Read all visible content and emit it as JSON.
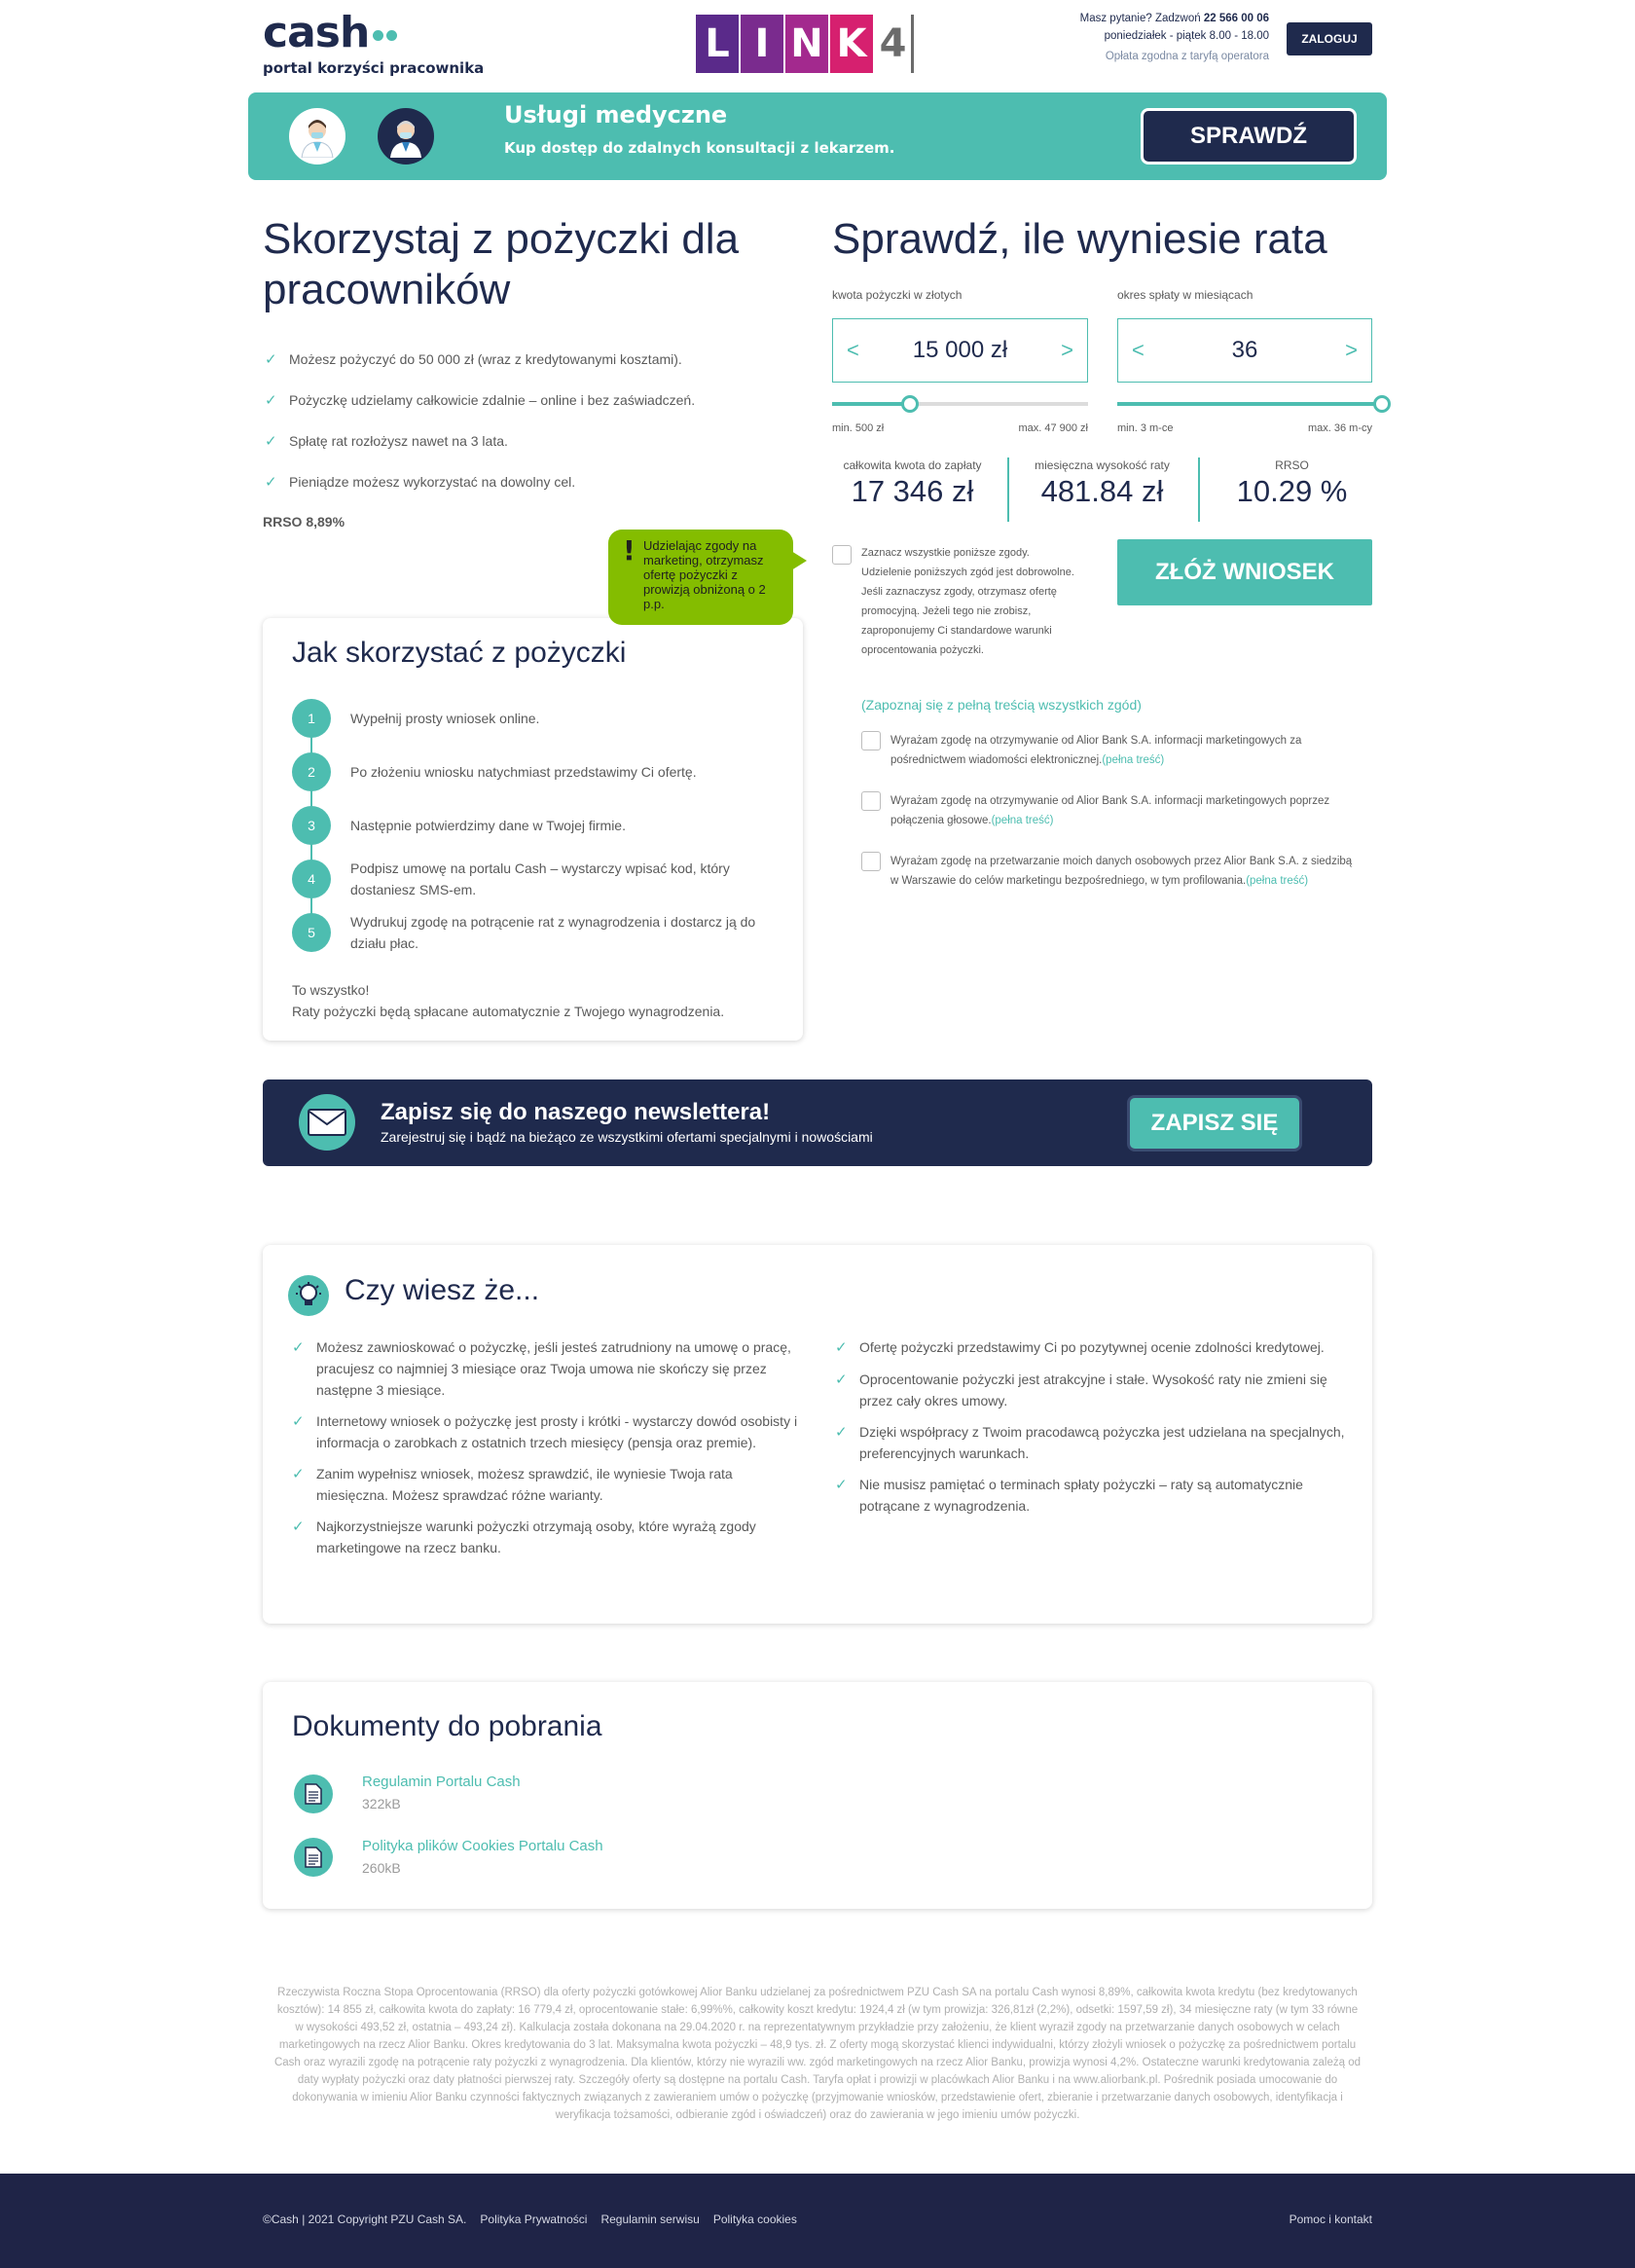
{
  "header": {
    "logo_text": "cash",
    "logo_sub": "portal korzyści pracownika",
    "partner_letters": [
      "L",
      "I",
      "N",
      "K",
      "4"
    ],
    "partner_colors": [
      "#5a2a8a",
      "#7a2b8e",
      "#a3298e",
      "#d6206f"
    ],
    "contact_question": "Masz pytanie? Zadzwoń",
    "contact_phone": "22 566 00 06",
    "contact_hours": "poniedziałek - piątek 8.00 - 18.00",
    "contact_fee": "Opłata zgodna z taryfą operatora",
    "login_label": "ZALOGUJ"
  },
  "banner": {
    "title": "Usługi medyczne",
    "subtitle": "Kup dostęp do zdalnych konsultacji z lekarzem.",
    "button_label": "SPRAWDŹ"
  },
  "intro": {
    "heading": "Skorzystaj z pożyczki dla pracowników",
    "benefits": [
      "Możesz pożyczyć do 50 000 zł (wraz z kredytowanymi kosztami).",
      "Pożyczkę udzielamy całkowicie zdalnie – online i bez zaświadczeń.",
      "Spłatę rat rozłożysz nawet na 3 lata.",
      "Pieniądze możesz wykorzystać na dowolny cel."
    ],
    "rrso": "RRSO 8,89%"
  },
  "steps": {
    "title": "Jak skorzystać z pożyczki",
    "items": [
      {
        "num": "1",
        "text": "Wypełnij prosty wniosek online."
      },
      {
        "num": "2",
        "text": "Po złożeniu wniosku natychmiast przedstawimy Ci ofertę."
      },
      {
        "num": "3",
        "text": "Następnie potwierdzimy dane w Twojej firmie."
      },
      {
        "num": "4",
        "text": "Podpisz umowę na portalu Cash – wystarczy wpisać kod, który dostaniesz SMS-em."
      },
      {
        "num": "5",
        "text": "Wydrukuj zgodę na potrącenie rat z wynagrodzenia i dostarcz ją do działu płac."
      }
    ],
    "outro_1": "To wszystko!",
    "outro_2": "Raty pożyczki będą spłacane automatycznie z Twojego wynagrodzenia."
  },
  "calculator": {
    "heading": "Sprawdź, ile wyniesie rata",
    "amount_label": "kwota pożyczki w złotych",
    "amount_value": "15 000 zł",
    "amount_min": "min. 500 zł",
    "amount_max": "max. 47 900 zł",
    "amount_fraction": 0.305,
    "period_label": "okres spłaty w miesiącach",
    "period_value": "36",
    "period_min": "min. 3 m-ce",
    "period_max": "max. 36 m-cy",
    "period_fraction": 1.0,
    "total_label": "całkowita kwota do zapłaty",
    "total_value": "17 346 zł",
    "installment_label": "miesięczna wysokość raty",
    "installment_value": "481.84 zł",
    "rrso_label": "RRSO",
    "rrso_value": "10.29 %",
    "apply_label": "ZŁÓŻ WNIOSEK"
  },
  "consents": {
    "bubble_mark": "!",
    "bubble_text": "Udzielając zgody na marketing, otrzymasz ofertę pożyczki z prowizją obniżoną o 2 p.p.",
    "select_all": "Zaznacz wszystkie poniższe zgody. Udzielenie poniższych zgód jest dobrowolne. Jeśli zaznaczysz zgody, otrzymasz ofertę promocyjną. Jeżeli tego nie zrobisz, zaproponujemy Ci standardowe warunki oprocentowania pożyczki.",
    "full_link": "(Zapoznaj się z pełną treścią wszystkich zgód)",
    "items": [
      {
        "text": "Wyrażam zgodę na otrzymywanie od Alior Bank S.A. informacji marketingowych za pośrednictwem wiadomości elektronicznej.",
        "link": "(pełna treść)"
      },
      {
        "text": "Wyrażam zgodę na otrzymywanie od Alior Bank S.A. informacji marketingowych poprzez połączenia głosowe.",
        "link": "(pełna treść)"
      },
      {
        "text": "Wyrażam zgodę na przetwarzanie moich danych osobowych przez Alior Bank S.A. z siedzibą w Warszawie do celów marketingu bezpośredniego, w tym profilowania.",
        "link": "(pełna treść)"
      }
    ]
  },
  "newsletter": {
    "title": "Zapisz się do naszego newslettera!",
    "subtitle": "Zarejestruj się i bądź na bieżąco ze wszystkimi ofertami specjalnymi i nowościami",
    "button_label": "ZAPISZ SIĘ"
  },
  "did_you_know": {
    "title": "Czy wiesz że...",
    "left": [
      "Możesz zawnioskować o pożyczkę, jeśli jesteś zatrudniony na umowę o pracę, pracujesz co najmniej 3 miesiące oraz Twoja umowa nie skończy się przez następne 3 miesiące.",
      "Internetowy wniosek o pożyczkę jest prosty i krótki - wystarczy dowód osobisty i informacja o zarobkach z ostatnich trzech miesięcy (pensja oraz premie).",
      "Zanim wypełnisz wniosek, możesz sprawdzić, ile wyniesie Twoja rata miesięczna. Możesz sprawdzać różne warianty.",
      "Najkorzystniejsze warunki pożyczki otrzymają osoby, które wyrażą zgody marketingowe na rzecz banku."
    ],
    "right": [
      "Ofertę pożyczki przedstawimy Ci po pozytywnej ocenie zdolności kredytowej.",
      "Oprocentowanie pożyczki jest atrakcyjne i stałe. Wysokość raty nie zmieni się przez cały okres umowy.",
      "Dzięki współpracy z Twoim pracodawcą pożyczka jest udzielana na specjalnych, preferencyjnych warunkach.",
      "Nie musisz pamiętać o terminach spłaty pożyczki – raty są automatycznie potrącane z wynagrodzenia."
    ]
  },
  "documents": {
    "title": "Dokumenty do pobrania",
    "items": [
      {
        "name": "Regulamin Portalu Cash",
        "size": "322kB"
      },
      {
        "name": "Polityka plików Cookies Portalu Cash",
        "size": "260kB"
      }
    ]
  },
  "legal": {
    "text": "Rzeczywista Roczna Stopa Oprocentowania (RRSO) dla oferty pożyczki gotówkowej Alior Banku udzielanej za pośrednictwem PZU Cash SA na portalu Cash wynosi 8,89%, całkowita kwota kredytu (bez kredytowanych kosztów): 14 855 zł, całkowita kwota do zapłaty: 16 779,4 zł, oprocentowanie stałe: 6,99%%, całkowity koszt kredytu: 1924,4 zł (w tym prowizja: 326,81zł (2,2%), odsetki: 1597,59 zł), 34 miesięczne raty (w tym 33 równe w wysokości 493,52 zł, ostatnia – 493,24 zł). Kalkulacja została dokonana na 29.04.2020 r. na reprezentatywnym przykładzie przy założeniu, że klient wyraził zgody na przetwarzanie danych osobowych w celach marketingowych na rzecz Alior Banku. Okres kredytowania do 3 lat. Maksymalna kwota pożyczki – 48,9 tys. zł. Z oferty mogą skorzystać klienci indywidualni, którzy złożyli wniosek o pożyczkę za pośrednictwem portalu Cash oraz wyrazili zgodę na potrącenie raty pożyczki z wynagrodzenia. Dla klientów, którzy nie wyrazili ww. zgód marketingowych na rzecz Alior Banku, prowizja wynosi 4,2%. Ostateczne warunki kredytowania zależą od daty wypłaty pożyczki oraz daty płatności pierwszej raty. Szczegóły oferty są dostępne na portalu Cash. Taryfa opłat i prowizji w placówkach Alior Banku i na www.aliorbank.pl. Pośrednik posiada umocowanie do dokonywania w imieniu Alior Banku czynności faktycznych związanych z zawieraniem umów o pożyczkę (przyjmowanie wniosków, przedstawienie ofert, zbieranie i przetwarzanie danych osobowych, identyfikacja i weryfikacja tożsamości, odbieranie zgód i oświadczeń) oraz do zawierania w jego imieniu umów pożyczki."
  },
  "footer": {
    "copyright": "©Cash | 2021 Copyright PZU Cash SA.",
    "links": [
      "Polityka Prywatności",
      "Regulamin serwisu",
      "Polityka cookies"
    ],
    "help": "Pomoc i kontakt"
  },
  "colors": {
    "navy": "#1f2a4d",
    "teal": "#4dbdb0",
    "lime": "#84bd00",
    "footer": "#1f2447"
  }
}
